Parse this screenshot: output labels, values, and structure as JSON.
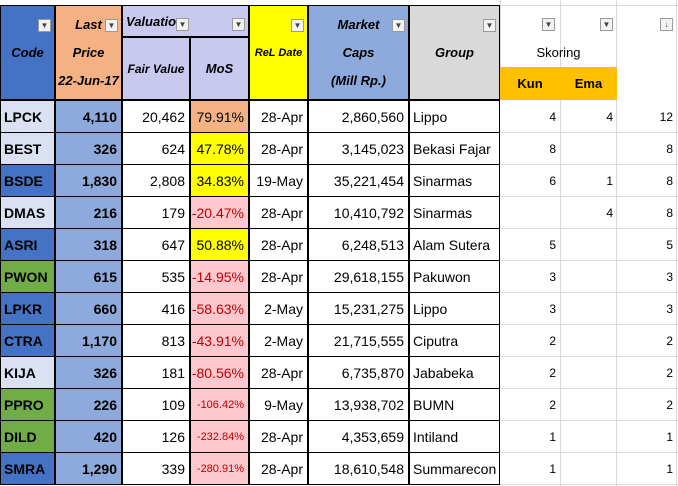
{
  "header": {
    "code": "Code",
    "last": "Last",
    "price": "Price",
    "date": "22-Jun-17",
    "valuation": "Valuatio",
    "fair_value": "Fair Value",
    "mos": "MoS",
    "rel_date": "ReL Date",
    "market": "Market",
    "caps": "Caps",
    "mill": "(Mill Rp.)",
    "group": "Group",
    "skoring": "Skoring",
    "kun": "Kun",
    "ema": "Ema"
  },
  "colors": {
    "code_blue": "#4472c4",
    "code_green": "#70ad47",
    "code_light": "#d9e1f2",
    "price_blue": "#8ea9db",
    "header_orange": "#f4b183",
    "header_yellow": "#ffff00",
    "header_lavender": "#c9c9f0",
    "header_blue": "#8ea9db",
    "group_gray": "#d9d9d9",
    "kun_ema_orange": "#ffc000",
    "mos_orange": "#f4b183",
    "mos_yellow": "#ffff00",
    "mos_pink": "#ffc7ce",
    "mos_red_text": "#c00000"
  },
  "rows": [
    {
      "code": "LPCK",
      "price": "4,110",
      "fair": "20,462",
      "mos": "79.91%",
      "date": "28-Apr",
      "caps": "2,860,560",
      "group": "Lippo",
      "kun": "4",
      "ema": "4",
      "total": "12",
      "code_bg": "light",
      "mos_bg": "orange"
    },
    {
      "code": "BEST",
      "price": "326",
      "fair": "624",
      "mos": "47.78%",
      "date": "28-Apr",
      "caps": "3,145,023",
      "group": "Bekasi Fajar",
      "kun": "8",
      "ema": "",
      "total": "8",
      "code_bg": "light",
      "mos_bg": "yellow"
    },
    {
      "code": "BSDE",
      "price": "1,830",
      "fair": "2,808",
      "mos": "34.83%",
      "date": "19-May",
      "caps": "35,221,454",
      "group": "Sinarmas",
      "kun": "6",
      "ema": "1",
      "total": "8",
      "code_bg": "blue",
      "mos_bg": "yellow"
    },
    {
      "code": "DMAS",
      "price": "216",
      "fair": "179",
      "mos": "-20.47%",
      "date": "28-Apr",
      "caps": "10,410,792",
      "group": "Sinarmas",
      "kun": "",
      "ema": "4",
      "total": "8",
      "code_bg": "light",
      "mos_bg": "pink"
    },
    {
      "code": "ASRI",
      "price": "318",
      "fair": "647",
      "mos": "50.88%",
      "date": "28-Apr",
      "caps": "6,248,513",
      "group": "Alam Sutera",
      "kun": "5",
      "ema": "",
      "total": "5",
      "code_bg": "blue",
      "mos_bg": "yellow"
    },
    {
      "code": "PWON",
      "price": "615",
      "fair": "535",
      "mos": "-14.95%",
      "date": "28-Apr",
      "caps": "29,618,155",
      "group": "Pakuwon",
      "kun": "3",
      "ema": "",
      "total": "3",
      "code_bg": "green",
      "mos_bg": "pink"
    },
    {
      "code": "LPKR",
      "price": "660",
      "fair": "416",
      "mos": "-58.63%",
      "date": "2-May",
      "caps": "15,231,275",
      "group": "Lippo",
      "kun": "3",
      "ema": "",
      "total": "3",
      "code_bg": "blue",
      "mos_bg": "pink"
    },
    {
      "code": "CTRA",
      "price": "1,170",
      "fair": "813",
      "mos": "-43.91%",
      "date": "2-May",
      "caps": "21,715,555",
      "group": "Ciputra",
      "kun": "2",
      "ema": "",
      "total": "2",
      "code_bg": "blue",
      "mos_bg": "pink"
    },
    {
      "code": "KIJA",
      "price": "326",
      "fair": "181",
      "mos": "-80.56%",
      "date": "28-Apr",
      "caps": "6,735,870",
      "group": "Jababeka",
      "kun": "2",
      "ema": "",
      "total": "2",
      "code_bg": "light",
      "mos_bg": "pink"
    },
    {
      "code": "PPRO",
      "price": "226",
      "fair": "109",
      "mos": "-106.42%",
      "date": "9-May",
      "caps": "13,938,702",
      "group": "BUMN",
      "kun": "2",
      "ema": "",
      "total": "2",
      "code_bg": "green",
      "mos_bg": "pink"
    },
    {
      "code": "DILD",
      "price": "420",
      "fair": "126",
      "mos": "-232.84%",
      "date": "28-Apr",
      "caps": "4,353,659",
      "group": "Intiland",
      "kun": "1",
      "ema": "",
      "total": "1",
      "code_bg": "green",
      "mos_bg": "pink"
    },
    {
      "code": "SMRA",
      "price": "1,290",
      "fair": "339",
      "mos": "-280.91%",
      "date": "28-Apr",
      "caps": "18,610,548",
      "group": "Summarecon",
      "kun": "1",
      "ema": "",
      "total": "1",
      "code_bg": "blue",
      "mos_bg": "pink"
    }
  ]
}
